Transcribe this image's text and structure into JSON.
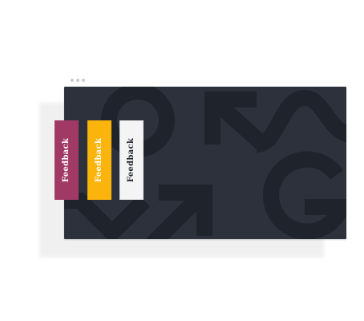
{
  "feedback_tabs": [
    {
      "label": "Feedback",
      "bg": "#a03a64",
      "fg": "#ffffff"
    },
    {
      "label": "Feedback",
      "bg": "#fbb40c",
      "fg": "#ffffff"
    },
    {
      "label": "Feedback",
      "bg": "#f4f4f5",
      "fg": "#23272f"
    }
  ],
  "colors": {
    "window_bg": "#2c313c",
    "pattern_stroke": "#1f232b",
    "shadow": "#f0f0f1",
    "window_dots": "#c9cbcf"
  }
}
